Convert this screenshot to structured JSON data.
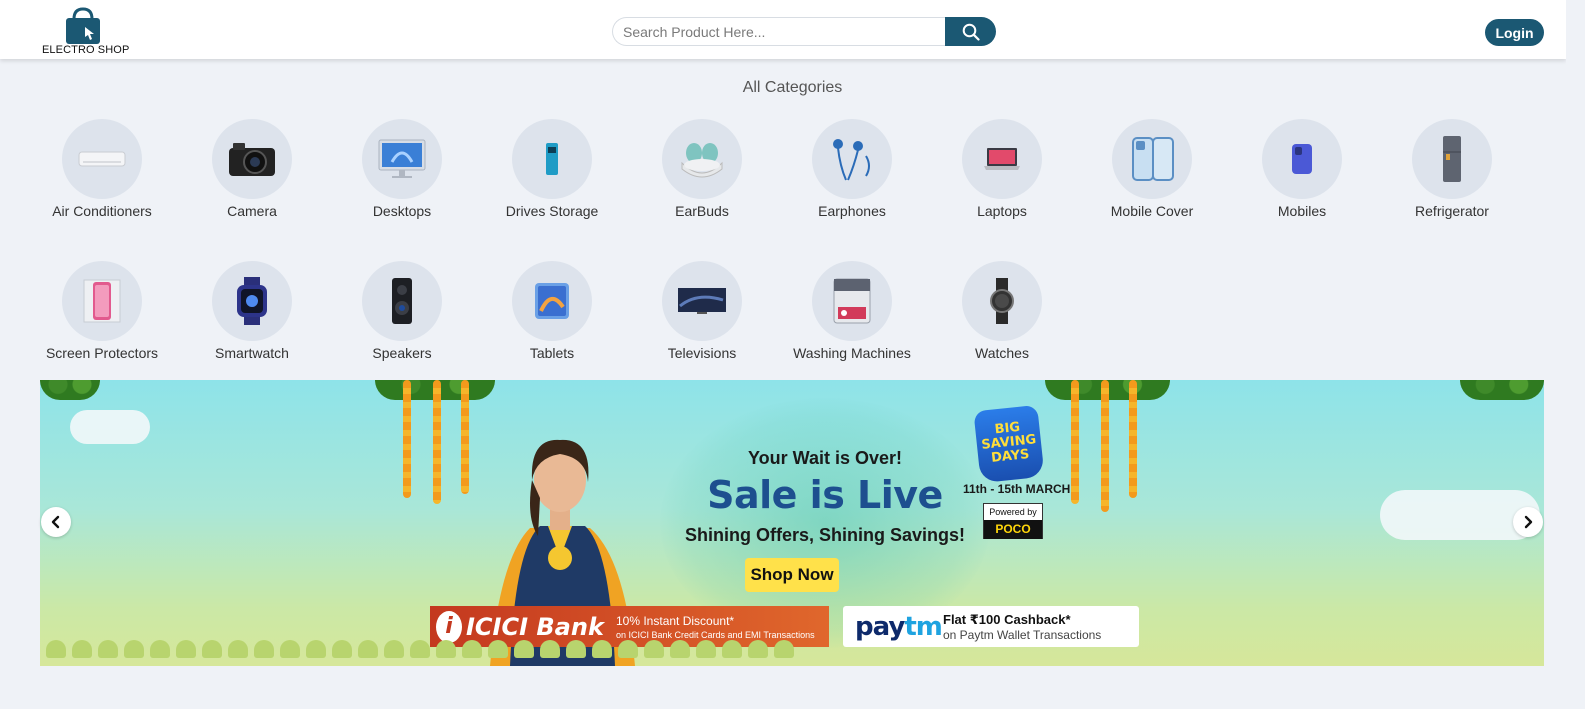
{
  "header": {
    "logo_text": "ELECTRO SHOP",
    "logo_icon": "shopping-bag-icon",
    "search_placeholder": "Search Product Here...",
    "search_value": "",
    "search_icon": "search-icon",
    "login_label": "Login",
    "accent_color": "#1b5873"
  },
  "categories": {
    "title": "All Categories",
    "items": [
      {
        "label": "Air Conditioners",
        "icon": "air-conditioner-icon"
      },
      {
        "label": "Camera",
        "icon": "camera-icon"
      },
      {
        "label": "Desktops",
        "icon": "desktop-icon"
      },
      {
        "label": "Drives Storage",
        "icon": "drive-storage-icon"
      },
      {
        "label": "EarBuds",
        "icon": "earbuds-icon"
      },
      {
        "label": "Earphones",
        "icon": "earphones-icon"
      },
      {
        "label": "Laptops",
        "icon": "laptop-icon"
      },
      {
        "label": "Mobile Cover",
        "icon": "mobile-cover-icon"
      },
      {
        "label": "Mobiles",
        "icon": "mobile-icon"
      },
      {
        "label": "Refrigerator",
        "icon": "refrigerator-icon"
      },
      {
        "label": "Screen Protectors",
        "icon": "screen-protector-icon"
      },
      {
        "label": "Smartwatch",
        "icon": "smartwatch-icon"
      },
      {
        "label": "Speakers",
        "icon": "speaker-icon"
      },
      {
        "label": "Tablets",
        "icon": "tablet-icon"
      },
      {
        "label": "Televisions",
        "icon": "television-icon"
      },
      {
        "label": "Washing Machines",
        "icon": "washing-machine-icon"
      },
      {
        "label": "Watches",
        "icon": "watch-icon"
      }
    ]
  },
  "banner": {
    "tagline": "Your Wait is Over!",
    "headline": "Sale is Live",
    "subline": "Shining Offers, Shining Savings!",
    "cta": "Shop Now",
    "event_badge_line1": "BIG",
    "event_badge_line2": "SAVING",
    "event_badge_line3": "DAYS",
    "event_dates": "11th - 15th MARCH",
    "powered_by": "Powered by",
    "sponsor": "POCO",
    "bank_name": "ICICI Bank",
    "bank_offer_line1": "10% Instant Discount*",
    "bank_offer_line2": "on ICICI Bank Credit Cards and EMI Transactions",
    "wallet_name_a": "pay",
    "wallet_name_b": "tm",
    "wallet_offer_line1": "Flat ₹100 Cashback*",
    "wallet_offer_line2": "on Paytm Wallet Transactions",
    "prev_icon": "chevron-left-icon",
    "next_icon": "chevron-right-icon"
  }
}
